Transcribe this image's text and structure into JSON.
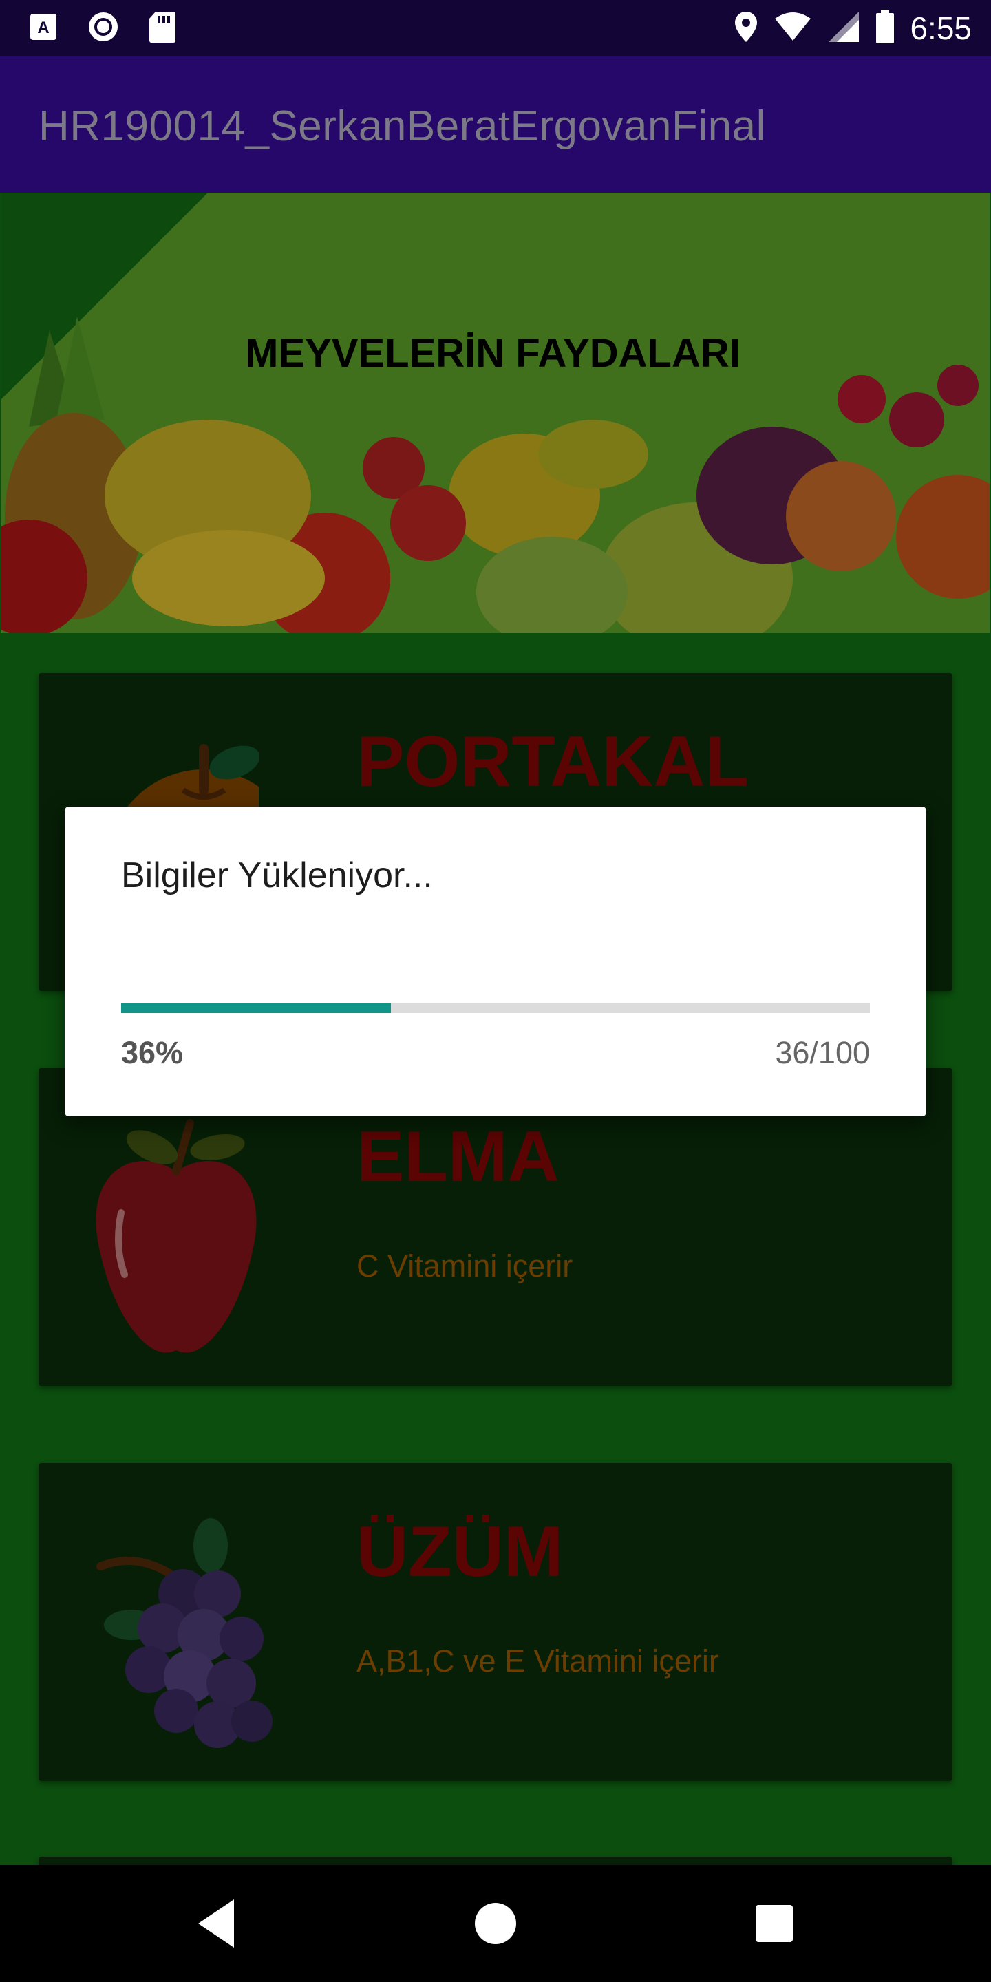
{
  "status_bar": {
    "time": "6:55",
    "icons": [
      "a-badge-icon",
      "radio-icon",
      "sd-card-icon",
      "location-icon",
      "wifi-icon",
      "signal-icon",
      "battery-icon"
    ]
  },
  "app_bar": {
    "title": "HR190014_SerkanBeratErgovanFinal"
  },
  "banner": {
    "title": "MEYVELERİN FAYDALARI"
  },
  "cards": [
    {
      "title": "PORTAKAL",
      "description": "",
      "icon": "orange-icon"
    },
    {
      "title": "ELMA",
      "description": "C Vitamini içerir",
      "icon": "apple-icon"
    },
    {
      "title": "ÜZÜM",
      "description": "A,B1,C ve E Vitamini içerir",
      "icon": "grapes-icon"
    }
  ],
  "dialog": {
    "message": "Bilgiler Yükleniyor...",
    "progress_percent_label": "36%",
    "progress_count_label": "36/100",
    "progress_value": 36,
    "progress_max": 100
  },
  "nav_bar": {
    "icons": [
      "back-icon",
      "home-icon",
      "recents-icon"
    ]
  },
  "colors": {
    "status_bar": "#130535",
    "app_bar": "#26086b",
    "background": "#0b4e0e",
    "card": "#061f06",
    "progress": "#0f9688"
  }
}
